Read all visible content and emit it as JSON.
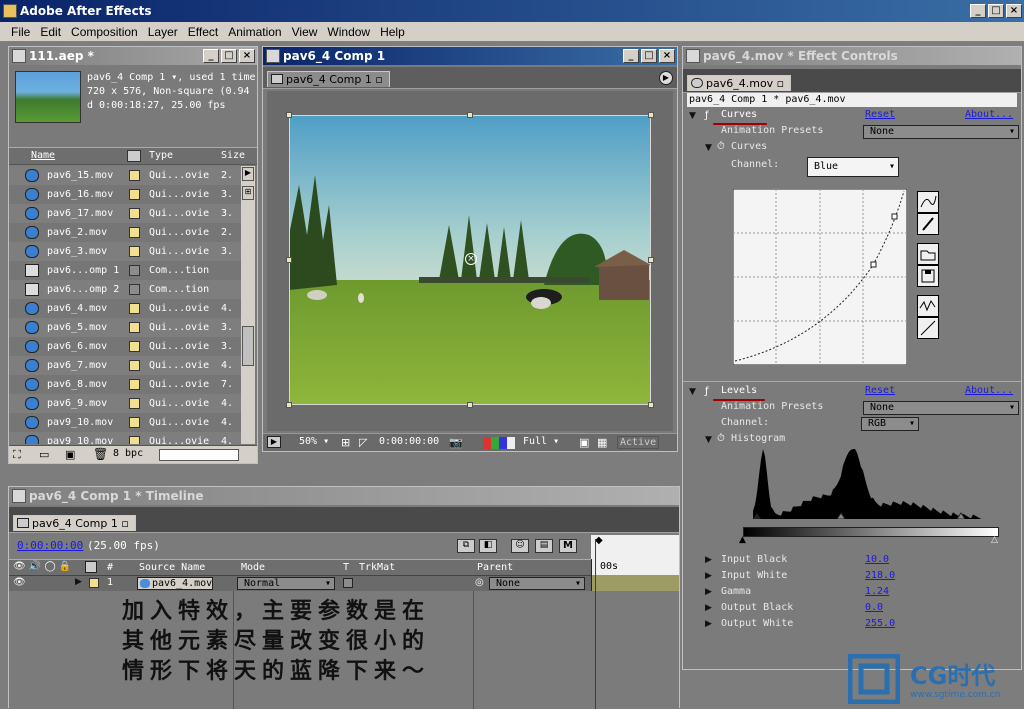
{
  "app": {
    "title": "Adobe After Effects"
  },
  "menu": [
    "File",
    "Edit",
    "Composition",
    "Layer",
    "Effect",
    "Animation",
    "View",
    "Window",
    "Help"
  ],
  "project": {
    "title": "111.aep *",
    "info_line1": "pav6_4 Comp 1 ▾, used 1 time",
    "info_line2": "720 x 576, Non-square (0.94",
    "info_line3": "d 0:00:18:27, 25.00 fps",
    "col_name": "Name",
    "col_type": "Type",
    "col_size": "Size",
    "items": [
      {
        "name": "pav6_15.mov",
        "type": "Qui...ovie",
        "size": "2."
      },
      {
        "name": "pav6_16.mov",
        "type": "Qui...ovie",
        "size": "3."
      },
      {
        "name": "pav6_17.mov",
        "type": "Qui...ovie",
        "size": "3."
      },
      {
        "name": "pav6_2.mov",
        "type": "Qui...ovie",
        "size": "2."
      },
      {
        "name": "pav6_3.mov",
        "type": "Qui...ovie",
        "size": "3."
      },
      {
        "name": "pav6...omp 1",
        "type": "Com...tion",
        "size": ""
      },
      {
        "name": "pav6...omp 2",
        "type": "Com...tion",
        "size": ""
      },
      {
        "name": "pav6_4.mov",
        "type": "Qui...ovie",
        "size": "4."
      },
      {
        "name": "pav6_5.mov",
        "type": "Qui...ovie",
        "size": "3."
      },
      {
        "name": "pav6_6.mov",
        "type": "Qui...ovie",
        "size": "3."
      },
      {
        "name": "pav6_7.mov",
        "type": "Qui...ovie",
        "size": "4."
      },
      {
        "name": "pav6_8.mov",
        "type": "Qui...ovie",
        "size": "7."
      },
      {
        "name": "pav6_9.mov",
        "type": "Qui...ovie",
        "size": "4."
      },
      {
        "name": "pav9_10.mov",
        "type": "Qui...ovie",
        "size": "4."
      },
      {
        "name": "pav9_10.mov",
        "type": "Qui...ovie",
        "size": "4."
      }
    ],
    "bpc": "8 bpc"
  },
  "comp": {
    "title": "pav6_4 Comp 1",
    "tab": "pav6_4 Comp 1",
    "zoom": "50%",
    "timecode": "0:00:00:00",
    "resolution": "Full",
    "view": "Active"
  },
  "effects": {
    "title": "pav6_4.mov * Effect Controls",
    "tab": "pav6_4.mov",
    "path": "pav6_4 Comp 1 * pav6_4.mov",
    "curves": {
      "name": "Curves",
      "reset": "Reset",
      "about": "About...",
      "presets_label": "Animation Presets",
      "presets_value": "None",
      "prop": "Curves",
      "channel_label": "Channel:",
      "channel_value": "Blue"
    },
    "levels": {
      "name": "Levels",
      "reset": "Reset",
      "about": "About...",
      "presets_label": "Animation Presets",
      "presets_value": "None",
      "channel_label": "Channel:",
      "channel_value": "RGB",
      "histogram": "Histogram",
      "params": [
        {
          "label": "Input Black",
          "value": "10.0"
        },
        {
          "label": "Input White",
          "value": "218.0"
        },
        {
          "label": "Gamma",
          "value": "1.24"
        },
        {
          "label": "Output Black",
          "value": "0.0"
        },
        {
          "label": "Output White",
          "value": "255.0"
        }
      ]
    }
  },
  "timeline": {
    "title": "pav6_4 Comp 1 * Timeline",
    "tab": "pav6_4 Comp 1",
    "timecode": "0:00:00:00",
    "fps": "(25.00 fps)",
    "col_hash": "#",
    "col_source": "Source Name",
    "col_mode": "Mode",
    "col_t": "T",
    "col_trkmat": "TrkMat",
    "col_parent": "Parent",
    "ruler_start": "00s",
    "layer": {
      "index": "1",
      "name": "pav6_4.mov",
      "mode": "Normal",
      "parent": "None"
    }
  },
  "annotation": {
    "line1": "加入特效，主要参数是在",
    "line2": "其他元素尽量改变很小的",
    "line3": "情形下将天的蓝降下来～"
  },
  "watermark": {
    "brand": "CG时代",
    "url": "www.sgtime.com.cn"
  },
  "colors": {
    "titlebar": "#0a246a",
    "panel": "#7b7b7b",
    "link": "#1a1ae0",
    "underline": "#a00000"
  }
}
